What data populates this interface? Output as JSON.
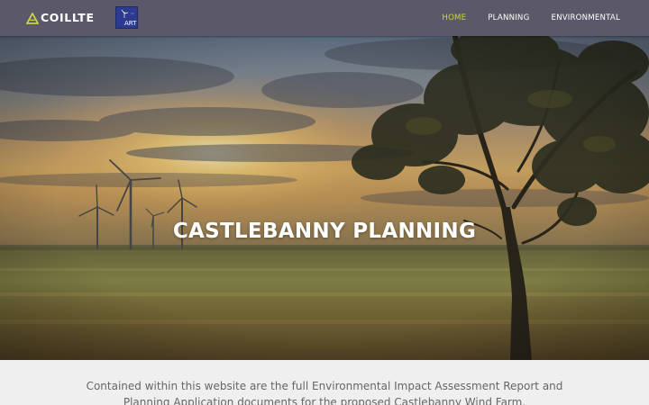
{
  "header": {
    "brand": "COILLTE",
    "partner_logo": "ART",
    "nav": [
      {
        "label": "HOME",
        "active": true
      },
      {
        "label": "PLANNING",
        "active": false
      },
      {
        "label": "ENVIRONMENTAL",
        "active": false
      }
    ]
  },
  "hero": {
    "title": "CASTLEBANNY PLANNING",
    "image": "sunset-wind-farm-with-tree"
  },
  "intro": {
    "text": "Contained within this website are the full Environmental Impact Assessment Report and Planning Application documents for the proposed Castlebanny Wind Farm."
  },
  "colors": {
    "header_bg": "#5b5969",
    "nav_active": "#c9d43b",
    "nav_text": "#ffffff",
    "body_bg": "#efefef",
    "body_text": "#666666"
  }
}
